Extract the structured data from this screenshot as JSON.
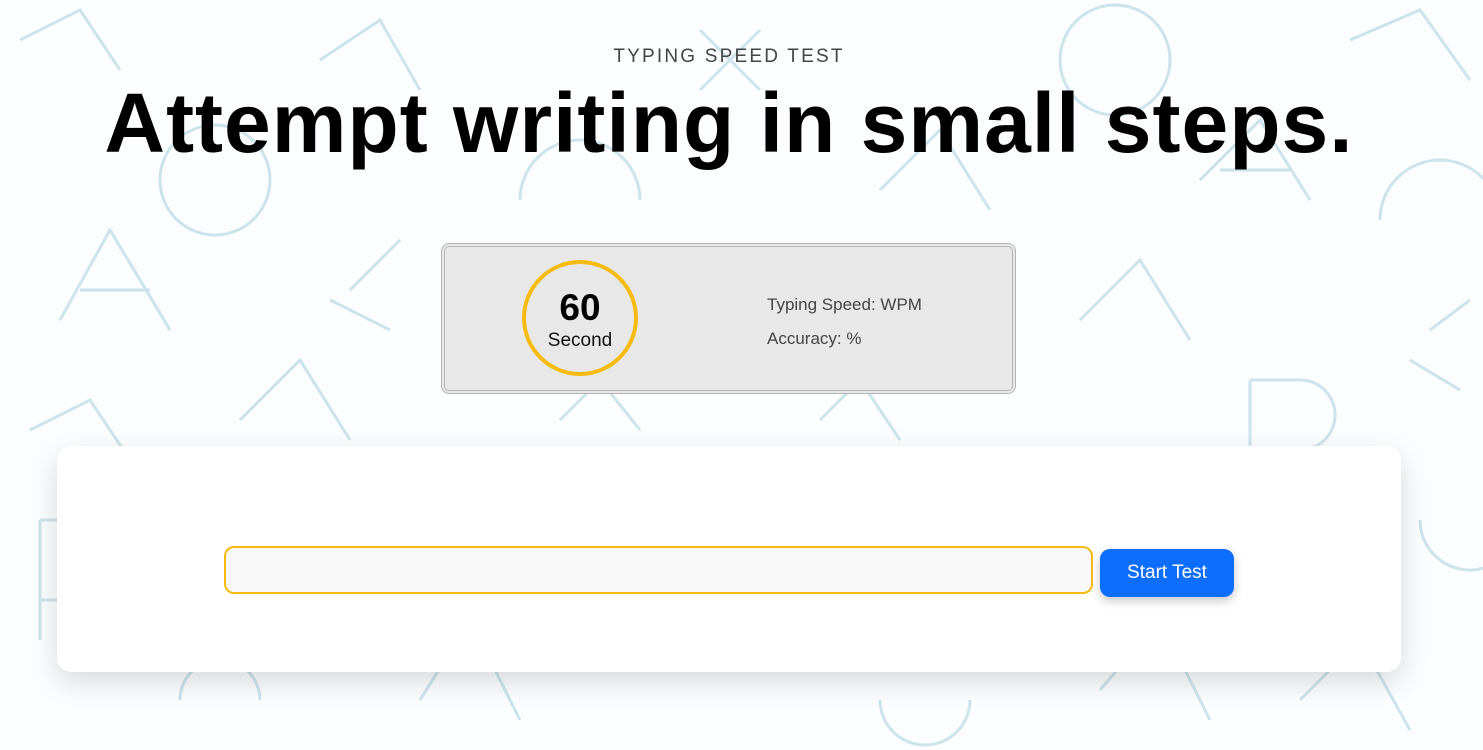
{
  "header": {
    "eyebrow": "TYPING SPEED TEST",
    "headline": "Attempt writing in small steps."
  },
  "stats": {
    "timer_value": "60",
    "timer_unit": "Second",
    "typing_speed_label": "Typing Speed: WPM",
    "accuracy_label": "Accuracy: %"
  },
  "typing_area": {
    "input_value": "",
    "start_button_label": "Start Test"
  },
  "colors": {
    "accent_yellow": "#f6bb12",
    "button_blue": "#0d6efd",
    "panel_gray": "#e8e8e8",
    "pattern_ink": "#7fb3c8"
  }
}
